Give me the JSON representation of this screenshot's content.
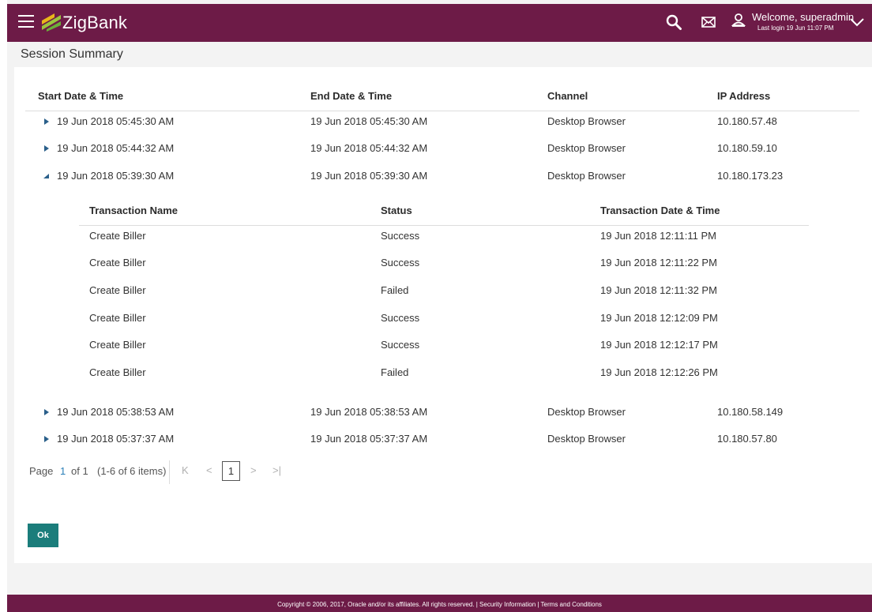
{
  "header": {
    "brand": "ZigBank",
    "welcome": "Welcome, superadmin",
    "last_login": "Last login 19 Jun 11:07 PM",
    "brand_color": "#6d1b47"
  },
  "page": {
    "title": "Session Summary"
  },
  "sessions": {
    "columns": [
      "Start Date & Time",
      "End Date & Time",
      "Channel",
      "IP Address"
    ],
    "rows": [
      {
        "start": "19 Jun 2018 05:45:30 AM",
        "end": "19 Jun 2018 05:45:30 AM",
        "channel": "Desktop Browser",
        "ip": "10.180.57.48",
        "expanded": false
      },
      {
        "start": "19 Jun 2018 05:44:32 AM",
        "end": "19 Jun 2018 05:44:32 AM",
        "channel": "Desktop Browser",
        "ip": "10.180.59.10",
        "expanded": false
      },
      {
        "start": "19 Jun 2018 05:39:30 AM",
        "end": "19 Jun 2018 05:39:30 AM",
        "channel": "Desktop Browser",
        "ip": "10.180.173.23",
        "expanded": true
      },
      {
        "start": "19 Jun 2018 05:38:53 AM",
        "end": "19 Jun 2018 05:38:53 AM",
        "channel": "Desktop Browser",
        "ip": "10.180.58.149",
        "expanded": false
      },
      {
        "start": "19 Jun 2018 05:37:37 AM",
        "end": "19 Jun 2018 05:37:37 AM",
        "channel": "Desktop Browser",
        "ip": "10.180.57.80",
        "expanded": false
      }
    ]
  },
  "transactions": {
    "columns": [
      "Transaction Name",
      "Status",
      "Transaction Date & Time"
    ],
    "rows": [
      {
        "name": "Create Biller",
        "status": "Success",
        "datetime": "19 Jun 2018 12:11:11 PM"
      },
      {
        "name": "Create Biller",
        "status": "Success",
        "datetime": "19 Jun 2018 12:11:22 PM"
      },
      {
        "name": "Create Biller",
        "status": "Failed",
        "datetime": "19 Jun 2018 12:11:32 PM"
      },
      {
        "name": "Create Biller",
        "status": "Success",
        "datetime": "19 Jun 2018 12:12:09 PM"
      },
      {
        "name": "Create Biller",
        "status": "Success",
        "datetime": "19 Jun 2018 12:12:17 PM"
      },
      {
        "name": "Create Biller",
        "status": "Failed",
        "datetime": "19 Jun 2018 12:12:26 PM"
      }
    ]
  },
  "pagination": {
    "page_label": "Page",
    "current": "1",
    "of_label": "of 1",
    "items_label": "(1-6 of 6 items)",
    "first": "K",
    "prev": "<",
    "next": ">",
    "last": ">|"
  },
  "actions": {
    "ok": "Ok"
  },
  "footer": {
    "text": "Copyright © 2006, 2017, Oracle and/or its affiliates. All rights reserved. | Security Information | Terms and Conditions"
  },
  "icons": {
    "menu": "hamburger-icon",
    "search": "search-icon",
    "mail": "mail-icon",
    "user": "user-icon",
    "dropdown": "chevron-down-icon",
    "expand": "caret-right-icon",
    "collapse": "caret-down-icon"
  },
  "colors": {
    "accent": "#1b7d7b",
    "page_link": "#2a7fb8",
    "logo_green": "#9bc53d",
    "logo_yellow": "#e8b71a"
  }
}
